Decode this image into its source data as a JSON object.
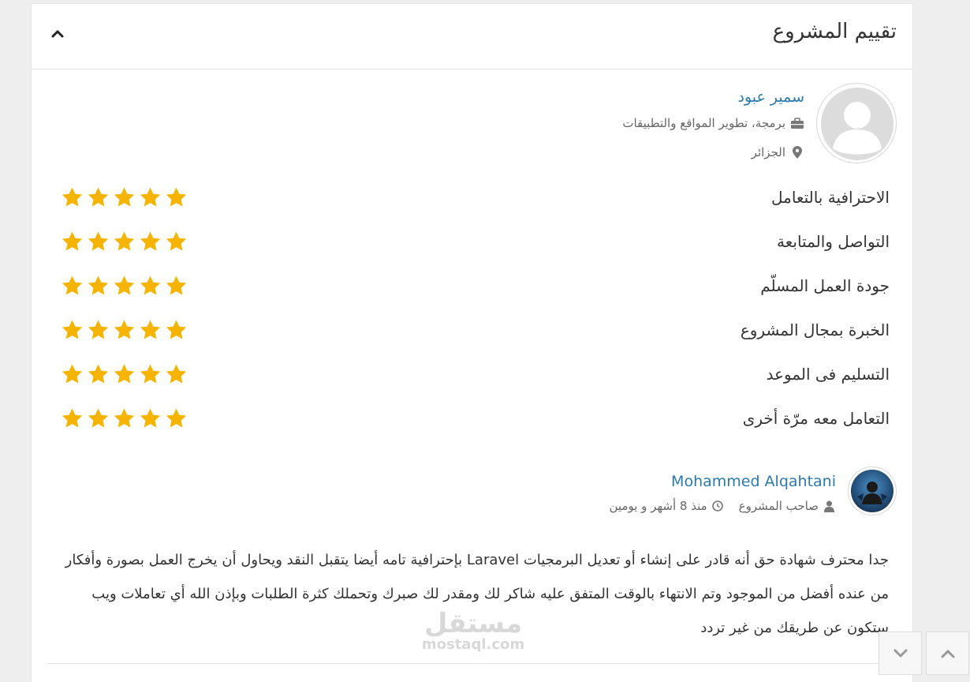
{
  "panel": {
    "title": "تقييم المشروع"
  },
  "reviewer": {
    "name": "سمير عبود",
    "skills": "برمجة، تطوير المواقع والتطبيقات",
    "location": "الجزائر",
    "avatar_icon": "default-user-icon"
  },
  "ratings": [
    {
      "label": "الاحترافية بالتعامل",
      "stars": 5
    },
    {
      "label": "التواصل والمتابعة",
      "stars": 5
    },
    {
      "label": "جودة العمل المسلّم",
      "stars": 5
    },
    {
      "label": "الخبرة بمجال المشروع",
      "stars": 5
    },
    {
      "label": "التسليم فى الموعد",
      "stars": 5
    },
    {
      "label": "التعامل معه مرّة أخرى",
      "stars": 5
    }
  ],
  "comment": {
    "author": "Mohammed Alqahtani",
    "role": "صاحب المشروع",
    "time": "منذ 8 أشهر و يومين",
    "text": "جدا محترف شهادة حق أنه قادر على إنشاء أو تعديل البرمجيات Laravel بإحترافية تامه أيضا يتقبل النقد ويحاول أن يخرج العمل بصورة وأفكار من عنده أفضل من الموجود وتم الانتهاء بالوقت المتفق عليه شاكر لك ومقدر لك صبرك وتحملك كثرة الطلبات وبإذن الله أي تعاملات ويب ستكون عن طريقك من غير تردد"
  },
  "watermark": {
    "arabic": "مستقل",
    "latin": "mostaql.com"
  },
  "colors": {
    "link": "#2a7ab0",
    "star": "#f5b400",
    "background": "#eeeeee"
  }
}
